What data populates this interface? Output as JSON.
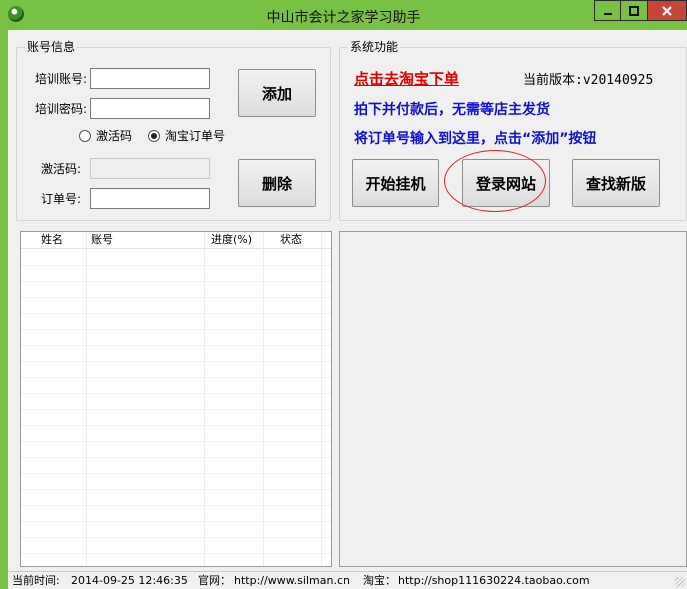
{
  "window": {
    "title": "中山市会计之家学习助手"
  },
  "account_group": {
    "label": "账号信息",
    "train_account_label": "培训账号:",
    "train_account_value": "",
    "train_password_label": "培训密码:",
    "train_password_value": "",
    "radio_activation": "激活码",
    "radio_taobao": "淘宝订单号",
    "activation_label": "激活码:",
    "activation_value": "",
    "order_label": "订单号:",
    "order_value": "",
    "add_button": "添加",
    "delete_button": "删除"
  },
  "system_group": {
    "label": "系统功能",
    "taobao_link": "点击去淘宝下单",
    "version": "当前版本:v20140925",
    "note_1": "拍下并付款后，无需等店主发货",
    "note_2": "将订单号输入到这里，点击“添加”按钮",
    "start_button": "开始挂机",
    "login_button": "登录网站",
    "find_button": "查找新版"
  },
  "list": {
    "columns": [
      "姓名",
      "账号",
      "进度(%)",
      "状态"
    ],
    "rows": []
  },
  "status_bar": {
    "time_label": "当前时间:",
    "time_value": "2014-09-25 12:46:35",
    "site_label": "官网：",
    "site_value": "http://www.silman.cn",
    "shop_label": "淘宝：",
    "shop_value": "http://shop111630224.taobao.com"
  },
  "colors": {
    "titlebar": "#79c145",
    "close": "#c7463a",
    "link_red": "#e00000",
    "text_blue": "#1010d0",
    "highlight_circle": "#dd2222"
  }
}
